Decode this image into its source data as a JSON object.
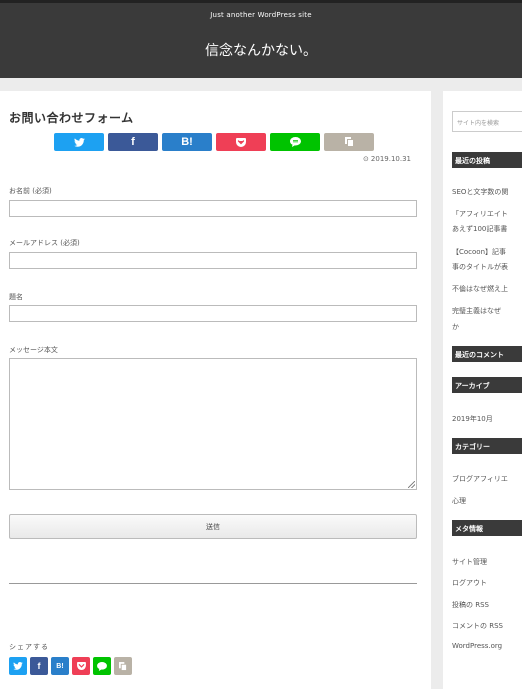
{
  "header": {
    "tagline": "Just another WordPress site",
    "site_title": "信念なんかない。"
  },
  "page": {
    "title": "お問い合わせフォーム",
    "date": "2019.10.31"
  },
  "share_buttons": [
    {
      "label": "",
      "icon": "twitter-icon",
      "color": "#1da1f2"
    },
    {
      "label": "f",
      "icon": "facebook-icon",
      "color": "#3b5998"
    },
    {
      "label": "B!",
      "icon": "hatena-icon",
      "color": "#2a7fca"
    },
    {
      "label": "",
      "icon": "pocket-icon",
      "color": "#ef3f56"
    },
    {
      "label": "",
      "icon": "line-icon",
      "color": "#00c300"
    },
    {
      "label": "",
      "icon": "copy-icon",
      "color": "#b9b2a6"
    }
  ],
  "form": {
    "name_label": "お名前 (必須)",
    "email_label": "メールアドレス (必須)",
    "subject_label": "題名",
    "message_label": "メッセージ本文",
    "submit_label": "送信"
  },
  "share_footer": {
    "label": "シェアする"
  },
  "sidebar": {
    "search_placeholder": "サイト内を検索",
    "recent_posts_title": "最近の投稿",
    "recent_posts": [
      "SEOと文字数の関",
      "「アフィリエイト",
      "あえず100記事書",
      "【Cocoon】記事",
      "事のタイトルが表",
      "不倫はなぜ燃え上",
      "完璧主義はなぜ",
      "か"
    ],
    "recent_comments_title": "最近のコメント",
    "archives_title": "アーカイブ",
    "archives": [
      "2019年10月"
    ],
    "categories_title": "カテゴリー",
    "categories": [
      "ブログアフィリエ",
      "心理"
    ],
    "meta_title": "メタ情報",
    "meta": [
      "サイト管理",
      "ログアウト",
      "投稿の RSS",
      "コメントの RSS",
      "WordPress.org"
    ]
  },
  "colors": {
    "header_bg": "#3a3a3a",
    "page_bg": "#ececec",
    "widget_title_bg": "#3a3a3a"
  }
}
